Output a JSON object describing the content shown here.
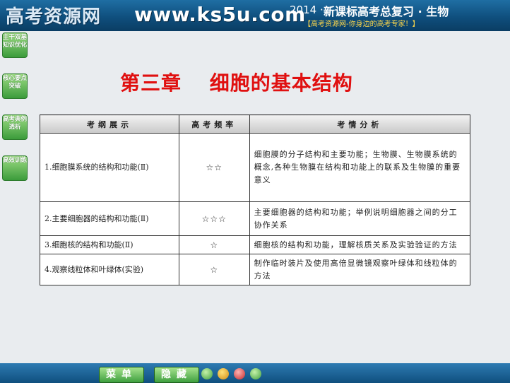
{
  "banner": {
    "logo": "高考资源网",
    "url": "www.ks5u.com",
    "year": "2014 ·",
    "course": "新课标高考总复习 · 生物",
    "slogan": "【高考资源网-你身边的高考专家！】"
  },
  "nav": [
    {
      "label": "主干双基知识优化"
    },
    {
      "label": "核心要点突破"
    },
    {
      "label": "高考典例透析"
    },
    {
      "label": "高效训练"
    }
  ],
  "title": "第三章　 细胞的基本结构",
  "table": {
    "headers": [
      "考纲展示",
      "高考频率",
      "考情分析"
    ],
    "rows": [
      {
        "topic": "1.细胞膜系统的结构和功能(Ⅱ)",
        "freq": "☆☆",
        "analysis": "细胞膜的分子结构和主要功能；生物膜、生物膜系统的概念,各种生物膜在结构和功能上的联系及生物膜的重要意义"
      },
      {
        "topic": "2.主要细胞器的结构和功能(Ⅱ)",
        "freq": "☆☆☆",
        "analysis": "主要细胞器的结构和功能；举例说明细胞器之间的分工协作关系"
      },
      {
        "topic": "3.细胞核的结构和功能(Ⅱ)",
        "freq": "☆",
        "analysis": "细胞核的结构和功能，理解核质关系及实验验证的方法"
      },
      {
        "topic": "4.观察线粒体和叶绿体(实验)",
        "freq": "☆",
        "analysis": "制作临时装片及使用高倍显微镜观察叶绿体和线粒体的方法"
      }
    ]
  },
  "bottom": {
    "menu_label": "菜单",
    "hide_label": "隐藏"
  }
}
